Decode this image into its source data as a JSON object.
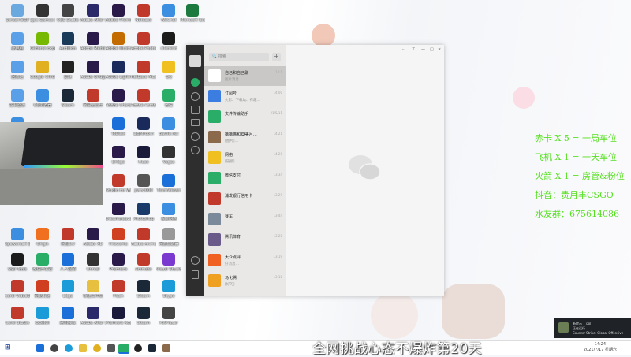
{
  "desktop_icons": [
    [
      "ScreenToGif",
      "#6aa9e0",
      6,
      2
    ],
    [
      "Epic Games Launcher",
      "#333333",
      38,
      2
    ],
    [
      "OBS Studio",
      "#444444",
      70,
      2
    ],
    [
      "Adobe After Effects",
      "#2a2a6a",
      102,
      2
    ],
    [
      "Adobe Premiere",
      "#2a1a4a",
      134,
      2
    ],
    [
      "Netease",
      "#c0392b",
      166,
      2
    ],
    [
      "WeChat",
      "#3b8ee0",
      198,
      2
    ],
    [
      "Microsoft Excel",
      "#1d7a3f",
      228,
      2
    ],
    [
      "此电脑",
      "#5aa0e8",
      6,
      38
    ],
    [
      "GeForce Experience",
      "#76b900",
      38,
      38
    ],
    [
      "Audition",
      "#1a3a5a",
      70,
      38
    ],
    [
      "Adobe Media Encoder",
      "#2a1a4a",
      102,
      38
    ],
    [
      "Adobe Illustrator",
      "#c46b00",
      134,
      38
    ],
    [
      "Adobe Photoshop",
      "#c0392b",
      166,
      38
    ],
    [
      "uTorrent",
      "#1c1c1c",
      198,
      38
    ],
    [
      "回收站",
      "#5aa0e8",
      6,
      74
    ],
    [
      "Google Chrome",
      "#e0b020",
      38,
      74
    ],
    [
      "剪映",
      "#222222",
      70,
      74
    ],
    [
      "Adobe Bridge",
      "#2a1a4a",
      102,
      74
    ],
    [
      "Adobe Lightroom",
      "#1a2a5a",
      134,
      74
    ],
    [
      "NetEase Music",
      "#c0392b",
      166,
      74
    ],
    [
      "QQ",
      "#f0c020",
      198,
      74
    ],
    [
      "控制面板",
      "#5aa0e8",
      6,
      110
    ],
    [
      "QQ浏览器",
      "#3b8ee0",
      38,
      110
    ],
    [
      "Steam",
      "#1b2838",
      70,
      110
    ],
    [
      "网易云音乐",
      "#c0392b",
      102,
      110
    ],
    [
      "Adobe Character",
      "#2a1a4a",
      134,
      110
    ],
    [
      "Adobe Acrobat",
      "#c0392b",
      166,
      110
    ],
    [
      "微信",
      "#2aae67",
      198,
      110
    ],
    [
      "Wallpaper",
      "#3b8ee0",
      6,
      146
    ],
    [
      "ToDesk",
      "#1b6fd8",
      134,
      146
    ],
    [
      "Lightroom",
      "#1a2a5a",
      166,
      146
    ],
    [
      "Battle.net",
      "#3b8ee0",
      198,
      146
    ],
    [
      "Bridge",
      "#2a1a4a",
      134,
      182
    ],
    [
      "Muse",
      "#1a1a3a",
      166,
      182
    ],
    [
      "Vegas",
      "#333333",
      198,
      182
    ],
    [
      "Studio for Windows",
      "#c0392b",
      134,
      218
    ],
    [
      "jwm2000",
      "#555555",
      166,
      218
    ],
    [
      "TeamViewer",
      "#1b6fd8",
      198,
      218
    ],
    [
      "Dreamweaver",
      "#2a1a4a",
      134,
      254
    ],
    [
      "Photoshop",
      "#1a3a6a",
      166,
      254
    ],
    [
      "百度网盘",
      "#3b8ee0",
      198,
      254
    ],
    [
      "Apowersoft 录屏",
      "#3b8ee0",
      6,
      286
    ],
    [
      "Origin",
      "#f07020",
      38,
      286
    ],
    [
      "网易UU",
      "#c0392b",
      70,
      286
    ],
    [
      "Adobe XD",
      "#2a1a4a",
      102,
      286
    ],
    [
      "Fireworks",
      "#d04020",
      134,
      286
    ],
    [
      "Adobe Animate",
      "#c0392b",
      166,
      286
    ],
    [
      "网游加速器",
      "#999999",
      198,
      286
    ],
    [
      "SSD Tools",
      "#1c1c1c",
      6,
      318
    ],
    [
      "微信开发者",
      "#2aae67",
      38,
      318
    ],
    [
      "人人视频",
      "#1b6fd8",
      70,
      318
    ],
    [
      "Unreal",
      "#333333",
      102,
      318
    ],
    [
      "Premiere",
      "#2a1a4a",
      134,
      318
    ],
    [
      "Animate",
      "#c0392b",
      166,
      318
    ],
    [
      "Visual Studio",
      "#7a3ad0",
      198,
      318
    ],
    [
      "Corel VideoStudio",
      "#c0392b",
      6,
      352
    ],
    [
      "网易有道",
      "#d04020",
      38,
      352
    ],
    [
      "Edge",
      "#1b9bd8",
      70,
      352
    ],
    [
      "新建文件夹",
      "#e8c040",
      102,
      352
    ],
    [
      "Flash",
      "#c0392b",
      134,
      352
    ],
    [
      "Steam",
      "#1b2838",
      166,
      352
    ],
    [
      "Skype",
      "#1b9bd8",
      198,
      352
    ],
    [
      "Corel Studio",
      "#c0392b",
      6,
      386
    ],
    [
      "QQ音乐",
      "#1b9bd8",
      38,
      386
    ],
    [
      "腾讯会议",
      "#1b6fd8",
      70,
      386
    ],
    [
      "Adobe After Effects CC",
      "#2a2a6a",
      102,
      386
    ],
    [
      "Premiere Rush",
      "#1a1a3a",
      134,
      386
    ],
    [
      "Steam",
      "#1b2838",
      166,
      386
    ],
    [
      "PotPlayer",
      "#444444",
      198,
      386
    ]
  ],
  "wechat": {
    "search_placeholder": "搜索",
    "add_label": "+",
    "window_buttons": [
      "⋯",
      "⊤",
      "—",
      "□",
      "✕"
    ],
    "chats": [
      {
        "name": "自己和自己聊",
        "preview": "图片消息",
        "time": "14:1",
        "color": "#ffffff",
        "selected": true
      },
      {
        "name": "订阅号",
        "preview": "火影、下载站、有趣…",
        "time": "14:00",
        "color": "#3b7de0",
        "selected": false
      },
      {
        "name": "文件传输助手",
        "preview": "",
        "time": "21/5/11",
        "color": "#2aae67",
        "selected": false
      },
      {
        "name": "撸撸猫和🐵美月…",
        "preview": "[图片]…",
        "time": "14:21",
        "color": "#8a6a4a",
        "selected": false
      },
      {
        "name": "网络",
        "preview": "[链接]",
        "time": "14:20",
        "color": "#f0c020",
        "selected": false
      },
      {
        "name": "微信支付",
        "preview": "",
        "time": "13:34",
        "color": "#2aae67",
        "selected": false
      },
      {
        "name": "浦发银行信用卡",
        "preview": "",
        "time": "13:29",
        "color": "#c0392b",
        "selected": false
      },
      {
        "name": "赛车",
        "preview": "",
        "time": "13:44",
        "color": "#7a8a9a",
        "selected": false
      },
      {
        "name": "腾讯体育",
        "preview": "",
        "time": "13:28",
        "color": "#6a5a8a",
        "selected": false
      },
      {
        "name": "大众点评",
        "preview": "好消息…",
        "time": "13:19",
        "color": "#f06020",
        "selected": false
      },
      {
        "name": "马化腾",
        "preview": "[好的]",
        "time": "13:18",
        "color": "#f0a020",
        "selected": false
      }
    ]
  },
  "overlay_lines": [
    "赤卡 X 5 = 一局车位",
    "飞机 X 1 = 一天车位",
    "火箭 X 1 = 房管&粉位",
    "抖音：贵月丰CSGO",
    "水友群：675614086"
  ],
  "banner": "全网挑战心态不爆炸第20天",
  "notification": {
    "title": "新提示 ：pol",
    "line2": "正在运行",
    "line3": "Counter-Strike: Global Offensive"
  },
  "clock": {
    "time": "14:24",
    "date": "2021/7/17 星期六"
  },
  "taskbar_apps": [
    "start",
    "search",
    "task-view",
    "explorer",
    "chrome",
    "wechat",
    "obs",
    "steam",
    "file"
  ],
  "colors": {
    "overlay_green": "#56e020",
    "wechat_sidebar": "#2e2e2e"
  }
}
